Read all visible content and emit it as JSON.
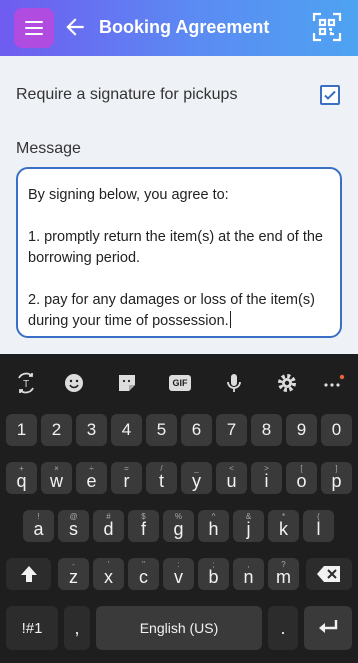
{
  "header": {
    "title": "Booking Agreement",
    "menu_icon": "menu-icon",
    "back_icon": "back-arrow-icon",
    "scan_icon": "qr-scan-icon"
  },
  "form": {
    "signature_label": "Require a signature for pickups",
    "signature_checked": true,
    "message_label": "Message",
    "message_lines": [
      "By signing below, you agree to:",
      "1. promptly return the item(s) at the end of the borrowing period.",
      "2. pay for any damages or loss of the item(s) during your time of possession."
    ]
  },
  "keyboard": {
    "toolbar": [
      "translate-icon",
      "emoji-icon",
      "sticker-icon",
      "gif-icon",
      "mic-icon",
      "settings-icon",
      "more-icon"
    ],
    "gif_label": "GIF",
    "row_numbers": [
      "1",
      "2",
      "3",
      "4",
      "5",
      "6",
      "7",
      "8",
      "9",
      "0"
    ],
    "row1": [
      {
        "k": "q",
        "s": "+"
      },
      {
        "k": "w",
        "s": "×"
      },
      {
        "k": "e",
        "s": "÷"
      },
      {
        "k": "r",
        "s": "="
      },
      {
        "k": "t",
        "s": "/"
      },
      {
        "k": "y",
        "s": "_"
      },
      {
        "k": "u",
        "s": "<"
      },
      {
        "k": "i",
        "s": ">"
      },
      {
        "k": "o",
        "s": "["
      },
      {
        "k": "p",
        "s": "]"
      }
    ],
    "row2": [
      {
        "k": "a",
        "s": "!"
      },
      {
        "k": "s",
        "s": "@"
      },
      {
        "k": "d",
        "s": "#"
      },
      {
        "k": "f",
        "s": "$"
      },
      {
        "k": "g",
        "s": "%"
      },
      {
        "k": "h",
        "s": "^"
      },
      {
        "k": "j",
        "s": "&"
      },
      {
        "k": "k",
        "s": "*"
      },
      {
        "k": "l",
        "s": "("
      }
    ],
    "row3": [
      {
        "k": "z",
        "s": "-"
      },
      {
        "k": "x",
        "s": "'"
      },
      {
        "k": "c",
        "s": "\""
      },
      {
        "k": "v",
        "s": ":"
      },
      {
        "k": "b",
        "s": ";"
      },
      {
        "k": "n",
        "s": ","
      },
      {
        "k": "m",
        "s": "?"
      }
    ],
    "symbols_label": "!#1",
    "comma_label": ",",
    "space_label": "English (US)",
    "period_label": "."
  },
  "colors": {
    "accent": "#3a6fc5",
    "menu_button": "#b04de0",
    "keyboard_bg": "#1e1e1e",
    "key_bg": "#3a3a3a"
  }
}
